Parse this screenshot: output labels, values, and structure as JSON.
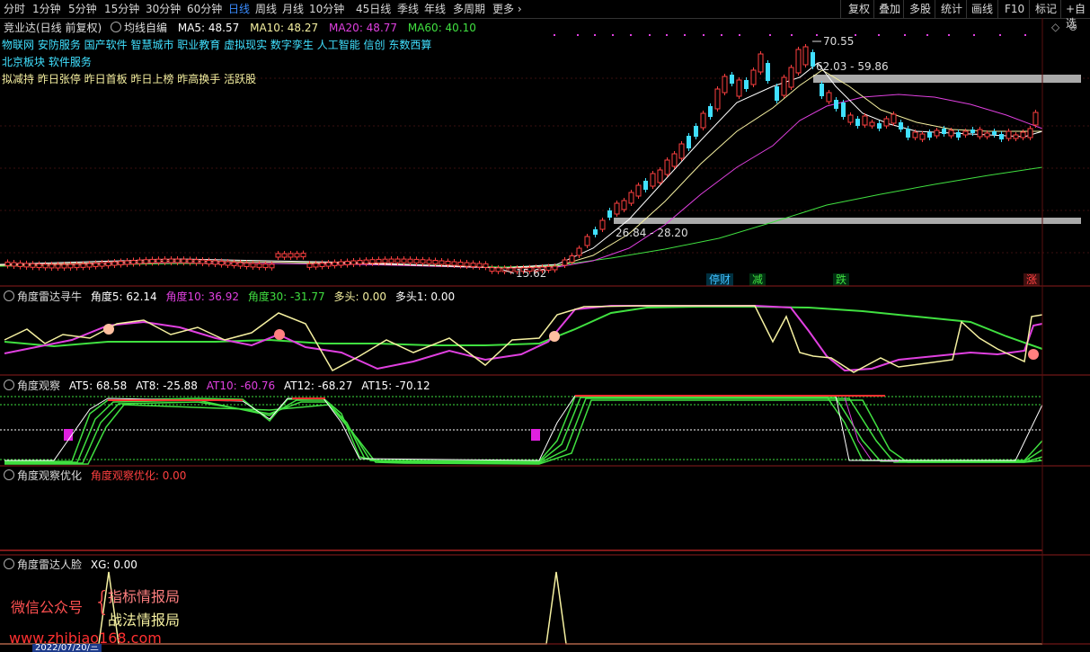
{
  "toolbar": {
    "tabs": [
      "分时",
      "1分钟",
      "5分钟",
      "15分钟",
      "30分钟",
      "60分钟",
      "日线",
      "周线",
      "月线",
      "10分钟",
      "45日线",
      "季线",
      "年线",
      "多周期",
      "更多"
    ],
    "active_tab": "日线",
    "right_buttons": [
      "复权",
      "叠加",
      "多股",
      "统计",
      "画线",
      "F10",
      "标记",
      "+自选"
    ]
  },
  "main_pane": {
    "title": "竞业达(日线 前复权)",
    "indicator": "均线自编",
    "ma": [
      {
        "label": "MA5: 48.57",
        "color": "#ffffff"
      },
      {
        "label": "MA10: 48.27",
        "color": "#f5f0a0"
      },
      {
        "label": "MA20: 48.77",
        "color": "#e040e0"
      },
      {
        "label": "MA60: 40.10",
        "color": "#40e040"
      }
    ],
    "concepts_line1": "物联网 安防服务 国产软件 智慧城市 职业教育 虚拟现实 数字孪生 人工智能 信创 东数西算",
    "concepts_line2": "北京板块  软件服务",
    "tags_line": "拟减持 昨日张停 昨日首板 昨日上榜 昨高换手 活跃股",
    "annotations": {
      "high": "70.55",
      "upper_range": "62.03 - 59.86",
      "lower_range": "26.84 - 28.20",
      "low": "15.62"
    },
    "event_markers": [
      {
        "text": "停财",
        "color": "#40c0ff"
      },
      {
        "text": "减",
        "color": "#40e040"
      },
      {
        "text": "跌",
        "color": "#40e040"
      },
      {
        "text": "涨",
        "color": "#ff4040"
      }
    ],
    "colors": {
      "up": "#ff4040",
      "down": "#40e0ff"
    }
  },
  "pane2": {
    "title": "角度雷达寻牛",
    "values": [
      {
        "label": "角度5: 62.14",
        "color": "#ffffff"
      },
      {
        "label": "角度10: 36.92",
        "color": "#e040e0"
      },
      {
        "label": "角度30: -31.77",
        "color": "#40e040"
      },
      {
        "label": "多头: 0.00",
        "color": "#f5f0a0"
      },
      {
        "label": "多头1: 0.00",
        "color": "#ffffff"
      }
    ]
  },
  "pane3": {
    "title": "角度观察",
    "values": [
      {
        "label": "AT5: 68.58",
        "color": "#ffffff"
      },
      {
        "label": "AT8: -25.88",
        "color": "#ffffff"
      },
      {
        "label": "AT10: -60.76",
        "color": "#e040e0"
      },
      {
        "label": "AT12: -68.27",
        "color": "#ffffff"
      },
      {
        "label": "AT15: -70.12",
        "color": "#ffffff"
      }
    ]
  },
  "pane4": {
    "title": "角度观察优化",
    "values": [
      {
        "label": "角度观察优化: 0.00",
        "color": "#ff4040"
      }
    ]
  },
  "pane5": {
    "title": "角度雷达人脸",
    "values": [
      {
        "label": "XG: 0.00",
        "color": "#ffffff"
      }
    ]
  },
  "watermark": {
    "wechat": "微信公众号",
    "brace": "{",
    "line1": "指标情报局",
    "line2": "战法情报局",
    "url": "www.zhibiao168.com"
  },
  "bottom_date": "2022/07/20/三"
}
